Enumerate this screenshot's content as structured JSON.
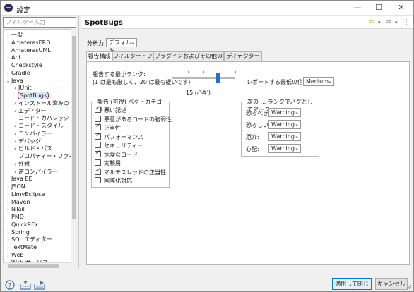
{
  "window": {
    "title": "設定",
    "minimize": "—",
    "maximize": "☐",
    "close": "✕"
  },
  "sidebar": {
    "filter_placeholder": "フィルター入力",
    "items": [
      {
        "label": "一般",
        "arrow": "›",
        "indent": 0
      },
      {
        "label": "AmaterasERD",
        "arrow": "›",
        "indent": 0
      },
      {
        "label": "AmaterasUML",
        "arrow": "",
        "indent": 0
      },
      {
        "label": "Ant",
        "arrow": "›",
        "indent": 0
      },
      {
        "label": "Checkstyle",
        "arrow": "",
        "indent": 0
      },
      {
        "label": "Gradle",
        "arrow": "›",
        "indent": 0
      },
      {
        "label": "Java",
        "arrow": "⌄",
        "indent": 0
      },
      {
        "label": "JUnit",
        "arrow": "›",
        "indent": 1
      },
      {
        "label": "SpotBugs",
        "arrow": "",
        "indent": 1,
        "selected": true
      },
      {
        "label": "インストール済みの JRE",
        "arrow": "›",
        "indent": 1
      },
      {
        "label": "エディター",
        "arrow": "›",
        "indent": 1
      },
      {
        "label": "コード・カバレッジ",
        "arrow": "",
        "indent": 1
      },
      {
        "label": "コード・スタイル",
        "arrow": "›",
        "indent": 1
      },
      {
        "label": "コンパイラー",
        "arrow": "›",
        "indent": 1
      },
      {
        "label": "デバッグ",
        "arrow": "›",
        "indent": 1
      },
      {
        "label": "ビルド・パス",
        "arrow": "›",
        "indent": 1
      },
      {
        "label": "プロパティー・ファイル・エディター",
        "arrow": "",
        "indent": 1
      },
      {
        "label": "外観",
        "arrow": "›",
        "indent": 1
      },
      {
        "label": "逆コンパイラー",
        "arrow": "›",
        "indent": 1
      },
      {
        "label": "Java EE",
        "arrow": "",
        "indent": 0
      },
      {
        "label": "JSON",
        "arrow": "›",
        "indent": 0
      },
      {
        "label": "LimyEclipse",
        "arrow": "›",
        "indent": 0
      },
      {
        "label": "Maven",
        "arrow": "›",
        "indent": 0
      },
      {
        "label": "NTail",
        "arrow": "›",
        "indent": 0
      },
      {
        "label": "PMD",
        "arrow": "",
        "indent": 0
      },
      {
        "label": "QuickREx",
        "arrow": "",
        "indent": 0
      },
      {
        "label": "Spring",
        "arrow": "›",
        "indent": 0
      },
      {
        "label": "SQL エディター",
        "arrow": "›",
        "indent": 0
      },
      {
        "label": "TextMate",
        "arrow": "›",
        "indent": 0
      },
      {
        "label": "Web",
        "arrow": "›",
        "indent": 0
      },
      {
        "label": "Web サービス",
        "arrow": "›",
        "indent": 0
      }
    ]
  },
  "page": {
    "title": "SpotBugs",
    "analysis_label": "分析力",
    "analysis_value": "デフォルト",
    "tabs": [
      "報告構成",
      "フィルター・ファイル",
      "プラグインおよびその他の設定",
      "ディテクター構成"
    ],
    "rank_label_line1": "報告する最小ランク:",
    "rank_label_line2": "(1 は最も厳しく、20 は最も緩いです)",
    "rank_value": 15,
    "rank_min": 1,
    "rank_max": 20,
    "rank_caption": "15 (心配)",
    "confidence_label": "レポートする最低の信頼度",
    "confidence_value": "Medium",
    "categories_title": "報告 (可視) バグ・カテゴリー",
    "categories": [
      {
        "label": "悪い記述",
        "checked": true
      },
      {
        "label": "悪意があるコードの脆弱性",
        "checked": false
      },
      {
        "label": "正当性",
        "checked": true
      },
      {
        "label": "パフォーマンス",
        "checked": true
      },
      {
        "label": "セキュリティー",
        "checked": false
      },
      {
        "label": "危険なコード",
        "checked": true
      },
      {
        "label": "実験用",
        "checked": false
      },
      {
        "label": "マルチスレッドの正当性",
        "checked": true
      },
      {
        "label": "国際化対応",
        "checked": false
      }
    ],
    "rank_marks_title": "次の ... ランクでバグとしてマーク:",
    "rank_marks": [
      {
        "label": "恐ろべき:",
        "value": "Warning"
      },
      {
        "label": "恐ろしい:",
        "value": "Warning"
      },
      {
        "label": "厄介:",
        "value": "Warning"
      },
      {
        "label": "心配:",
        "value": "Warning"
      }
    ]
  },
  "buttons": {
    "apply_close": "適用して閉じる",
    "cancel": "キャンセル"
  },
  "icons": {
    "help": "help-icon",
    "import": "import-icon",
    "export": "export-icon"
  },
  "colors": {
    "accent": "#1e6fd9",
    "selection_outline": "#e02424"
  }
}
